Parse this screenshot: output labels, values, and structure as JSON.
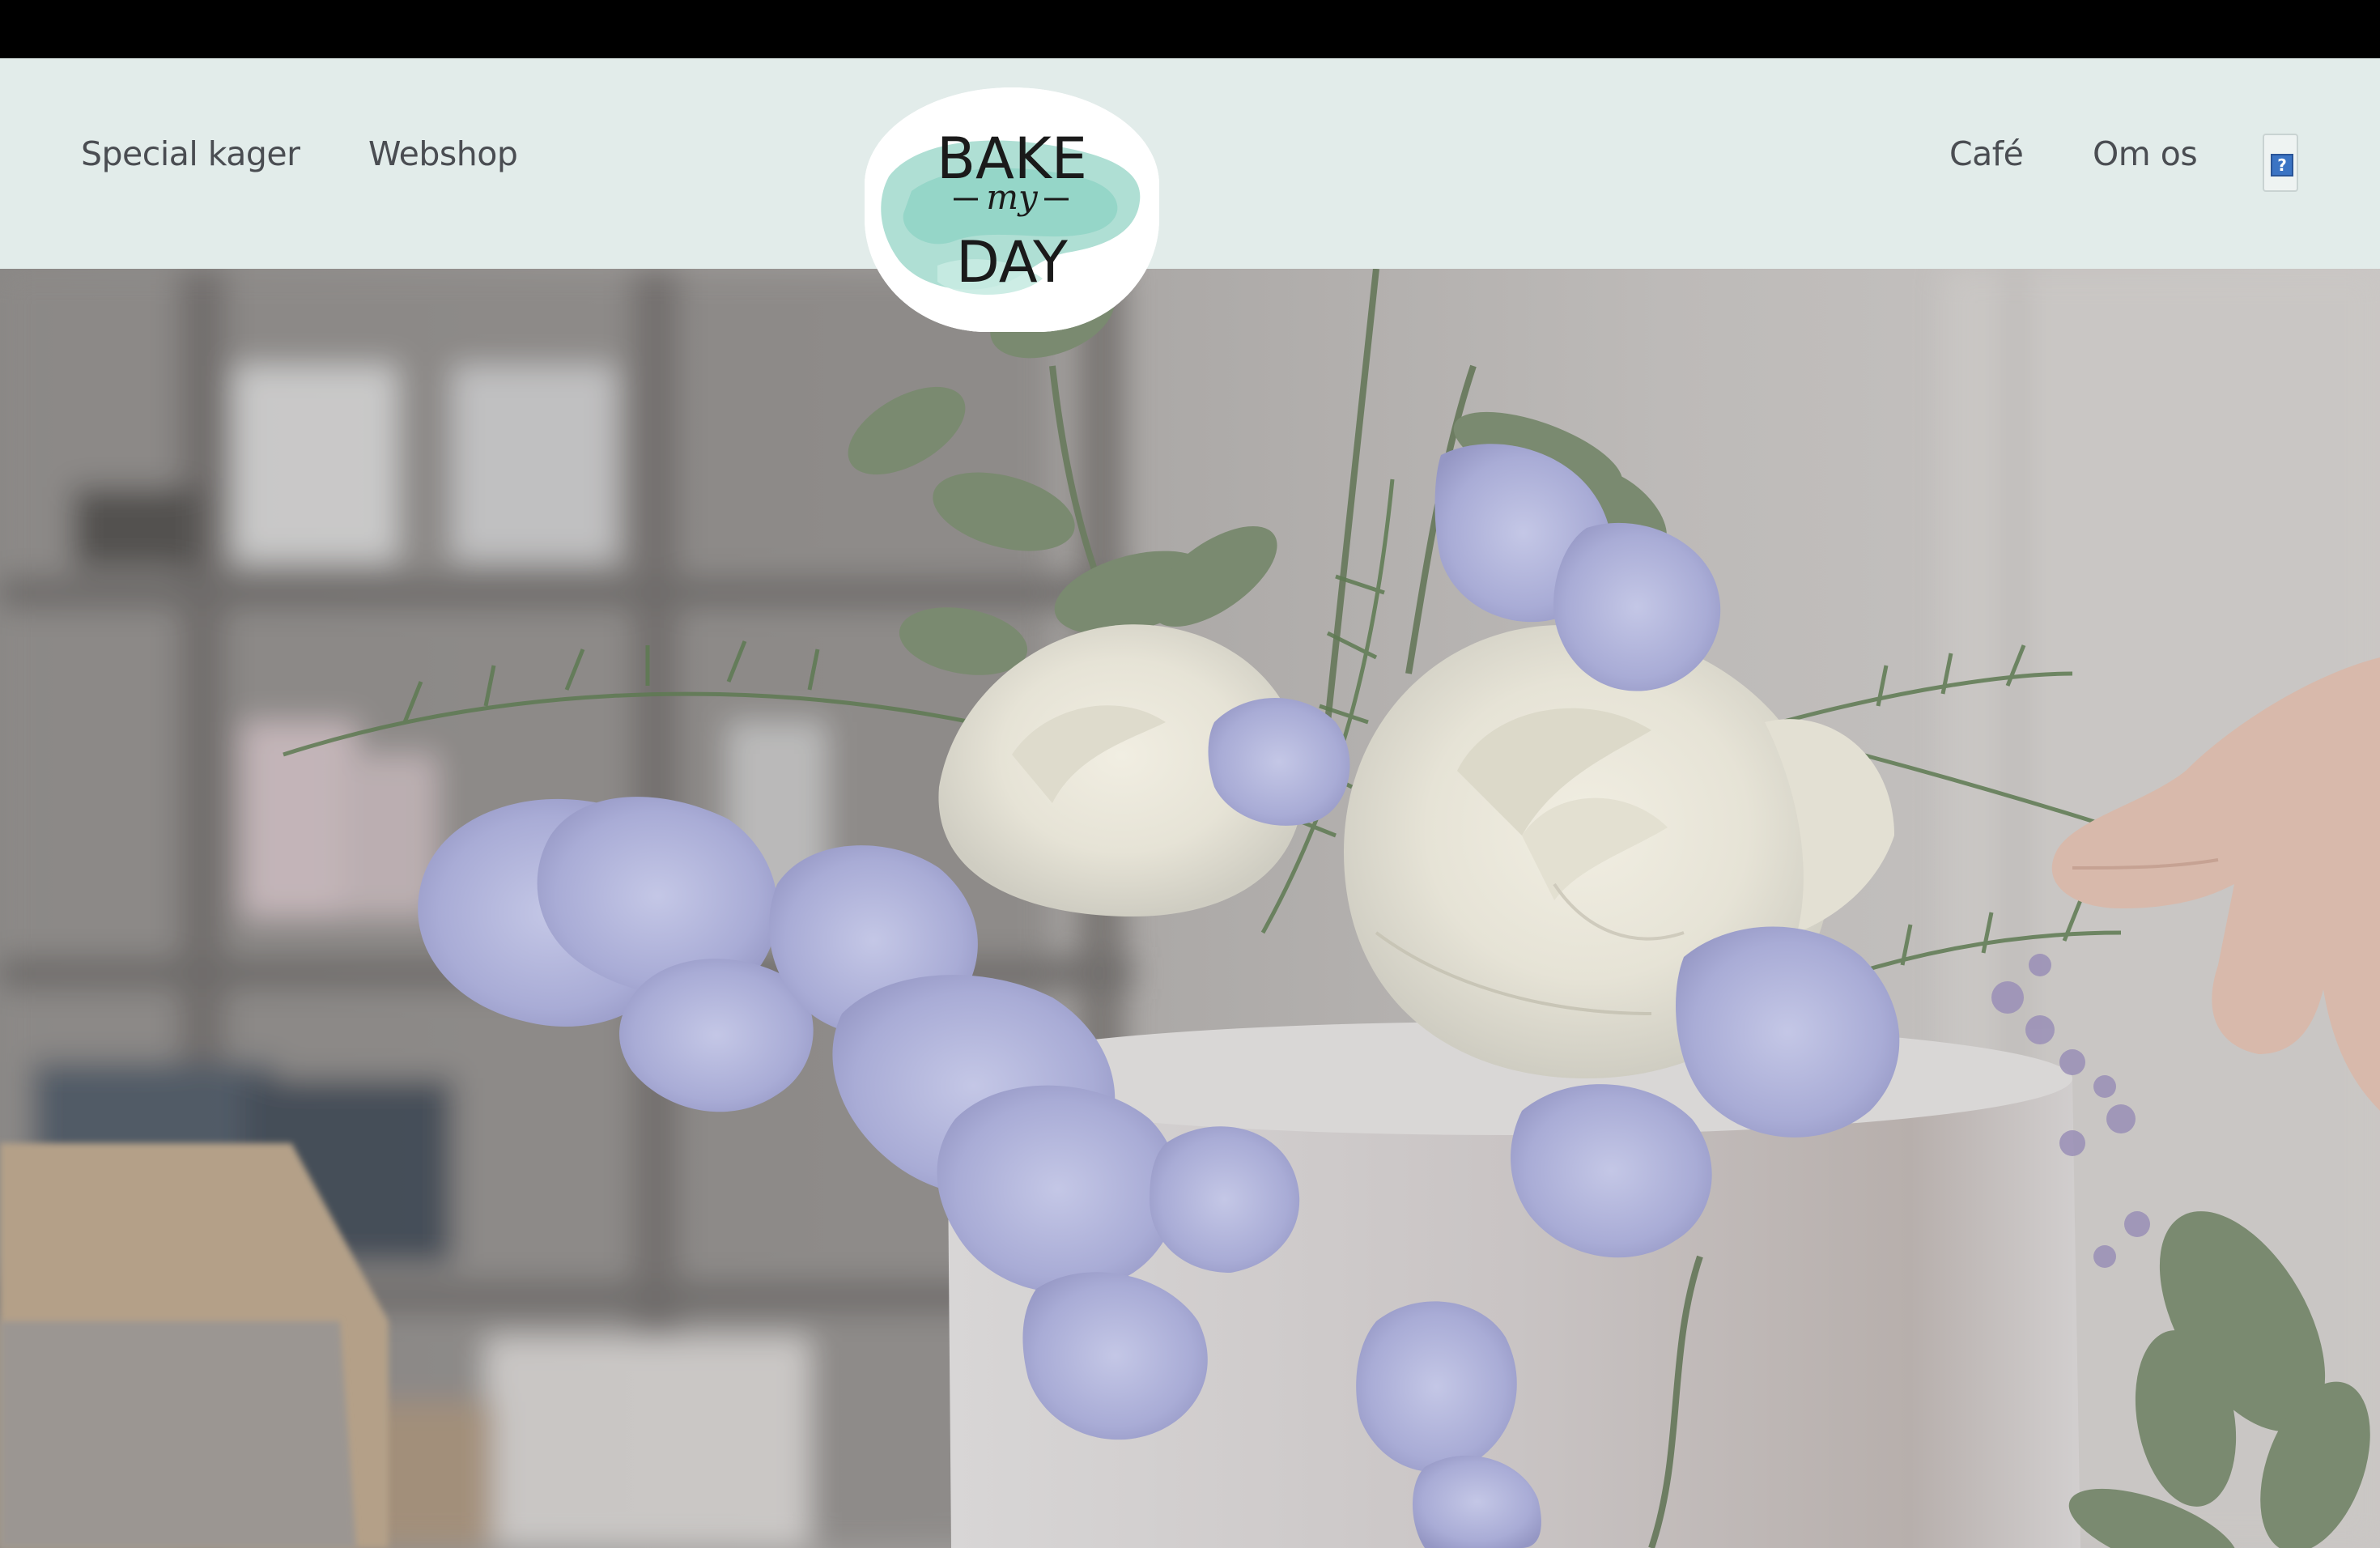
{
  "nav": {
    "left": [
      {
        "label": "Special kager"
      },
      {
        "label": "Webshop"
      }
    ],
    "right": [
      {
        "label": "Café"
      },
      {
        "label": "Om os"
      }
    ],
    "help_icon": "question-mark-icon",
    "help_glyph": "?"
  },
  "logo": {
    "line1": "BAKE",
    "line2": "my",
    "line3": "DAY"
  },
  "colors": {
    "header_bg": "#e2ecea",
    "nav_text": "#4a4d52",
    "logo_wash": "#8fd3c6"
  }
}
